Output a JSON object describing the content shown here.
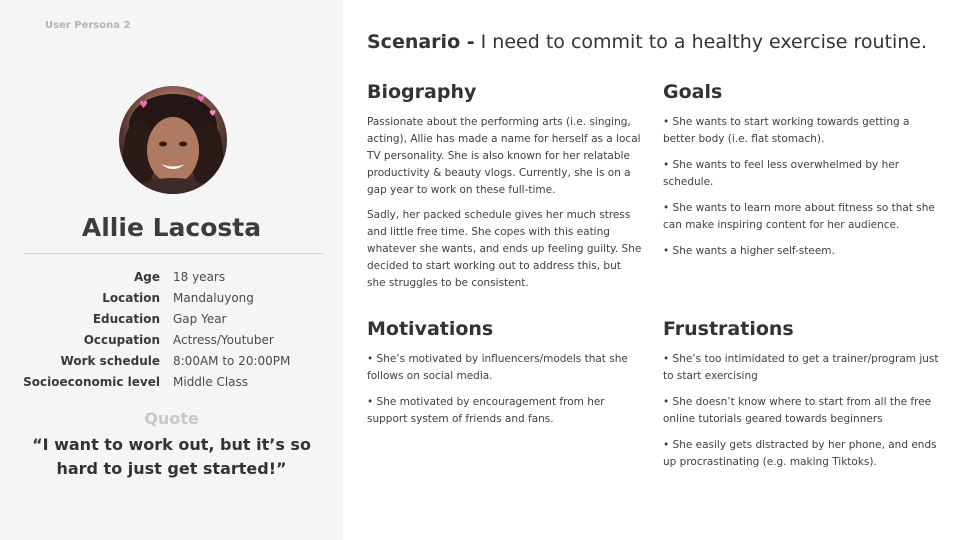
{
  "persona_tag": "User Persona 2",
  "profile": {
    "name": "Allie Lacosta",
    "details": [
      {
        "label": "Age",
        "value": "18 years"
      },
      {
        "label": "Location",
        "value": "Mandaluyong"
      },
      {
        "label": "Education",
        "value": "Gap Year"
      },
      {
        "label": "Occupation",
        "value": "Actress/Youtuber"
      },
      {
        "label": "Work schedule",
        "value": "8:00AM to 20:00PM"
      },
      {
        "label": "Socioeconomic level",
        "value": "Middle Class"
      }
    ],
    "quote_label": "Quote",
    "quote": "“I want to work out, but it’s so hard to just get started!”"
  },
  "scenario": {
    "label": "Scenario -",
    "text": " I need to commit to a healthy exercise routine."
  },
  "biography": {
    "title": "Biography",
    "paragraphs": [
      "Passionate about the performing arts (i.e. singing, acting), Allie has made a name for herself as a local TV personality. She is also known for her relatable productivity & beauty vlogs. Currently, she is on a gap year to work on these full-time.",
      "Sadly, her packed schedule gives her much stress and little free time. She copes with this eating whatever she wants, and ends up feeling guilty. She decided to start working out to address this, but she struggles to be consistent."
    ]
  },
  "goals": {
    "title": "Goals",
    "items": [
      "She wants to start working towards getting a better body (i.e. flat stomach).",
      "She wants to feel less overwhelmed by her schedule.",
      "She wants to learn more about fitness so that she can make inspiring content for her audience.",
      "She wants a higher self-steem."
    ]
  },
  "motivations": {
    "title": "Motivations",
    "items": [
      "She’s motivated by influencers/models that she follows on social media.",
      "She motivated by encouragement from her support system of friends and fans."
    ]
  },
  "frustrations": {
    "title": "Frustrations",
    "items": [
      "She’s too intimidated to get a trainer/program just to start exercising",
      "She doesn’t know where to start from all the free online tutorials geared towards beginners",
      "She easily gets distracted by her phone, and ends up procrastinating (e.g. making Tiktoks)."
    ]
  },
  "colors": {
    "sidebar_bg": "#f5f5f5",
    "text": "#333333",
    "muted": "#c8c8c8"
  }
}
